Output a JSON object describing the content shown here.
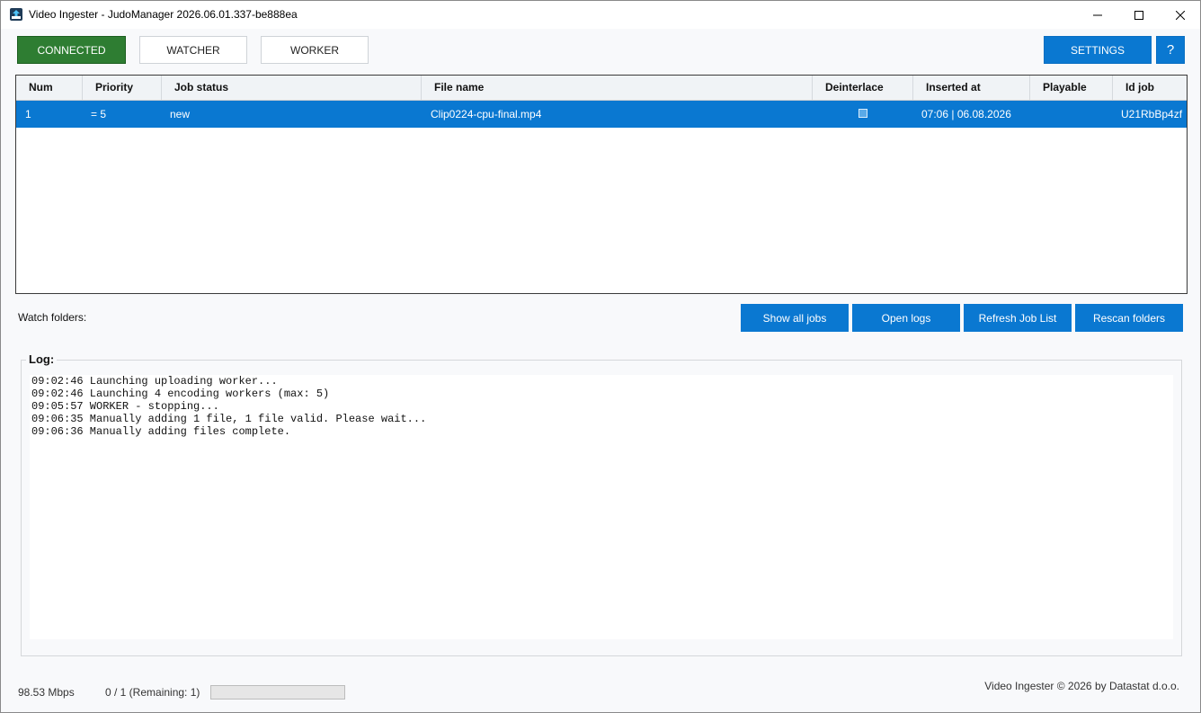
{
  "window": {
    "title": "Video Ingester - JudoManager  2026.06.01.337-be888ea",
    "icon": "upload-arrow-icon"
  },
  "toolbar": {
    "connected_label": "CONNECTED",
    "watcher_label": "WATCHER",
    "worker_label": "WORKER",
    "settings_label": "SETTINGS",
    "help_label": "?"
  },
  "colors": {
    "connected": "#2e7d32",
    "accent": "#0a78d1"
  },
  "job_table": {
    "columns": [
      "Num",
      "Priority",
      "Job status",
      "File name",
      "Deinterlace",
      "Inserted at",
      "Playable",
      "Id job"
    ],
    "rows": [
      {
        "num": "1",
        "priority": "= 5",
        "status": "new",
        "file_name": "Clip0224-cpu-final.mp4",
        "deinterlace": false,
        "inserted_at": "07:06 | 06.08.2026",
        "playable": "",
        "id_job": "U21RbBp4zf",
        "selected": true
      }
    ]
  },
  "watch_folders_label": "Watch folders:",
  "actions": {
    "show_all_jobs": "Show all jobs",
    "open_logs": "Open logs",
    "refresh_job_list": "Refresh Job List",
    "rescan_folders": "Rescan folders"
  },
  "log": {
    "title": "Log:",
    "lines": [
      "09:02:46 Launching uploading worker...",
      "09:02:46 Launching 4 encoding workers (max: 5)",
      "09:05:57 WORKER - stopping...",
      "09:06:35 Manually adding 1 file, 1 file valid. Please wait...",
      "09:06:36 Manually adding files complete."
    ]
  },
  "footer": {
    "speed": "98.53 Mbps",
    "count": "0 / 1 (Remaining: 1)",
    "progress": 0,
    "copyright": "Video Ingester © 2026 by Datastat d.o.o."
  }
}
